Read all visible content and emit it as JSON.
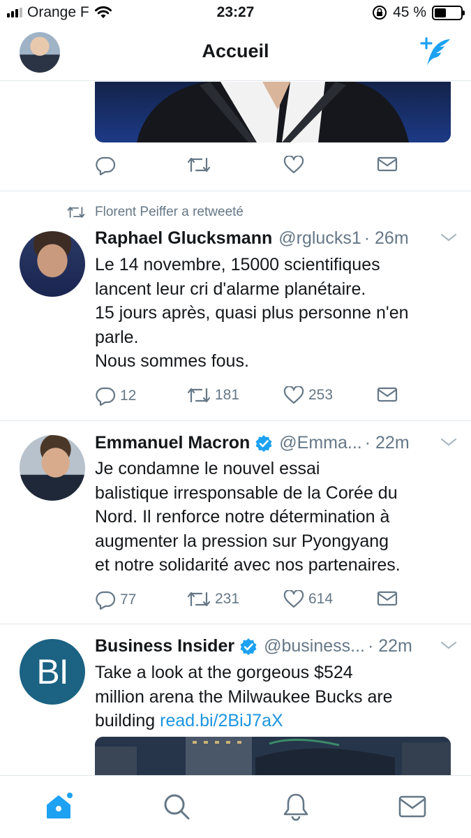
{
  "status_bar": {
    "carrier": "Orange F",
    "time": "23:27",
    "battery": "45 %",
    "battery_level": 0.45
  },
  "header": {
    "title": "Accueil",
    "avatar_icon": "profile-avatar",
    "compose_icon": "compose-tweet-icon"
  },
  "tweets": [
    {
      "retweeted_by": "Florent Peiffer a retweeté",
      "name": "Raphael Glucksmann",
      "handle": "@rglucks1",
      "time": "· 26m",
      "lines": [
        "Le 14 novembre, 15000 scientifiques",
        "lancent leur cri d'alarme planétaire.",
        "15 jours après, quasi plus personne n'en",
        "parle.",
        "Nous sommes fous."
      ],
      "replies": "12",
      "retweets": "181",
      "likes": "253"
    },
    {
      "name": "Emmanuel Macron",
      "verified": true,
      "handle": "@Emma...",
      "time": "· 22m",
      "lines": [
        "Je condamne le nouvel essai",
        "balistique irresponsable de la Corée du",
        "Nord. Il renforce notre détermination à",
        "augmenter la pression sur Pyongyang",
        "et notre solidarité avec nos partenaires."
      ],
      "replies": "77",
      "retweets": "231",
      "likes": "614"
    },
    {
      "name": "Business Insider",
      "verified": true,
      "handle": "@business...",
      "time": "· 22m",
      "avatar_text": "BI",
      "lines": [
        "Take a look at the gorgeous $524",
        "million arena the Milwaukee Bucks are"
      ],
      "last_line_prefix": "building ",
      "link": "read.bi/2BiJ7aX"
    }
  ],
  "tabbar": {
    "items": [
      "home-icon",
      "search-icon",
      "notifications-icon",
      "messages-icon"
    ],
    "active": "home-icon"
  },
  "colors": {
    "accent": "#1da1f2",
    "link": "#1b95e0",
    "muted": "#657786",
    "verified": "#1da1f2",
    "bi_brand": "#1b6283"
  }
}
